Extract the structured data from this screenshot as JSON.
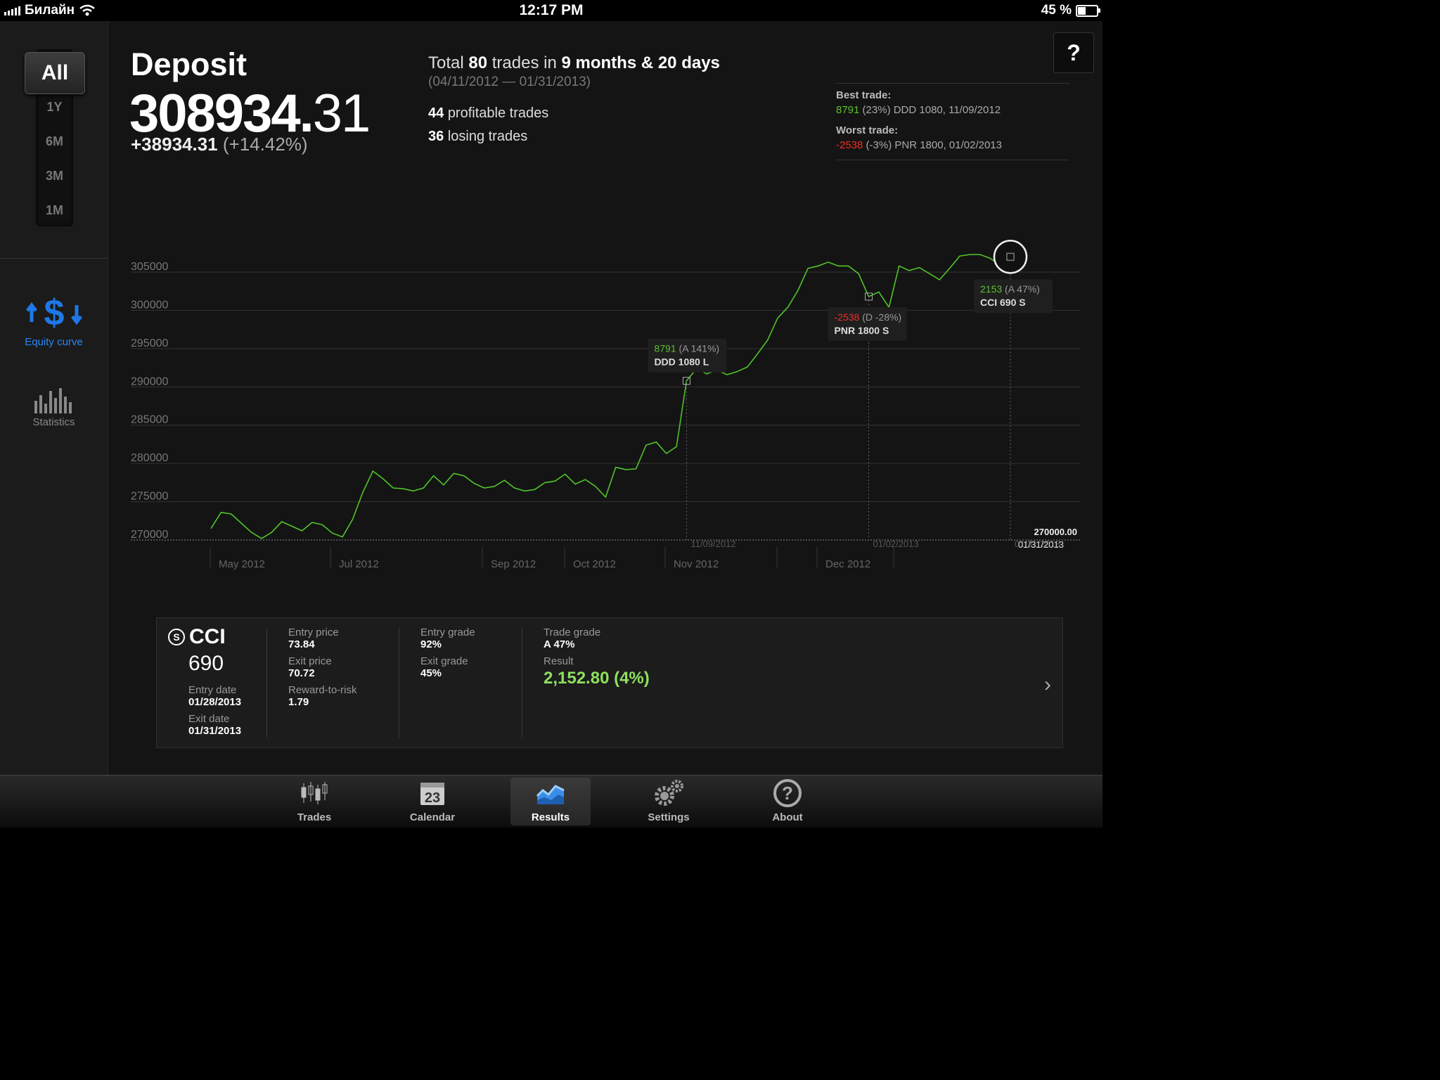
{
  "status_bar": {
    "carrier": "Билайн",
    "time": "12:17 PM",
    "battery": "45 %",
    "battery_level": 0.45
  },
  "sidebar": {
    "ranges": [
      "All",
      "1Y",
      "6M",
      "3M",
      "1M"
    ],
    "selected_range": "All",
    "nav": [
      {
        "label": "Equity curve",
        "icon": "equity-curve-icon",
        "active": true
      },
      {
        "label": "Statistics",
        "icon": "statistics-icon",
        "active": false
      }
    ]
  },
  "header": {
    "deposit_label": "Deposit",
    "deposit_whole": "308934.",
    "deposit_cents": "31",
    "change": "+38934.31",
    "change_pct": "(+14.42%)",
    "summary_prefix": "Total",
    "summary_trades": "80",
    "summary_mid": "trades in",
    "summary_period": "9 months & 20 days",
    "date_range": "(04/11/2012 — 01/31/2013)",
    "profitable_count": "44",
    "profitable_label": "profitable trades",
    "losing_count": "36",
    "losing_label": "losing trades",
    "help_label": "?",
    "best_trade_label": "Best trade:",
    "best_trade_value": "8791",
    "best_trade_rest": "(23%) DDD 1080, 11/09/2012",
    "worst_trade_label": "Worst trade:",
    "worst_trade_value": "-2538",
    "worst_trade_rest": "(-3%) PNR 1800, 01/02/2013"
  },
  "chart_data": {
    "type": "line",
    "ylim": [
      270000,
      305000
    ],
    "yticks": [
      "305000",
      "300000",
      "295000",
      "290000",
      "285000",
      "280000",
      "275000",
      "270000"
    ],
    "xticks": [
      "May 2012",
      "Jul 2012",
      "Sep 2012",
      "Oct 2012",
      "Nov 2012",
      "Dec 2012"
    ],
    "baseline_label": "270000.00",
    "baseline_date": "01/31/2013",
    "colors": {
      "line": "#4fc32a",
      "grid": "#333333"
    },
    "series": [
      {
        "values": [
          271500,
          273600,
          273400,
          272200,
          271000,
          270200,
          271000,
          272400,
          271800,
          271200,
          272300,
          272000,
          270900,
          270400,
          272700,
          276200,
          279000,
          278000,
          276800,
          276700,
          276400,
          276800,
          278400,
          277200,
          278700,
          278400,
          277400,
          276800,
          277000,
          277800,
          276800,
          276400,
          276600,
          277500,
          277700,
          278600,
          277300,
          277900,
          277000,
          275600,
          279500,
          279200,
          279300,
          282400,
          282800,
          281300,
          282200,
          290800,
          292400,
          291700,
          292200,
          291600,
          292000,
          292600,
          294300,
          296100,
          299000,
          300400,
          302600,
          305500,
          305800,
          306300,
          305800,
          305800,
          304800,
          301800,
          302400,
          300400,
          305800,
          305200,
          305600,
          304800,
          304000,
          305500,
          307100,
          307300,
          307300,
          306800,
          305900,
          307000
        ]
      }
    ],
    "annotations": [
      {
        "value": "8791",
        "grade": "(A 141%)",
        "trade": "DDD 1080 L",
        "date": "11/09/2012",
        "index": 47
      },
      {
        "value": "-2538",
        "grade": "(D -28%)",
        "trade": "PNR 1800 S",
        "date": "01/02/2013",
        "index": 65
      },
      {
        "value": "2153",
        "grade": "(A 47%)",
        "trade": "CCI 690 S",
        "date": "01/31/2013",
        "index": 79
      }
    ]
  },
  "trade_detail": {
    "symbol": "CCI",
    "quantity": "690",
    "entry_date_label": "Entry date",
    "entry_date": "01/28/2013",
    "exit_date_label": "Exit date",
    "exit_date": "01/31/2013",
    "entry_price_label": "Entry price",
    "entry_price": "73.84",
    "exit_price_label": "Exit price",
    "exit_price": "70.72",
    "reward_risk_label": "Reward-to-risk",
    "reward_risk": "1.79",
    "entry_grade_label": "Entry grade",
    "entry_grade": "92%",
    "exit_grade_label": "Exit grade",
    "exit_grade": "45%",
    "trade_grade_label": "Trade grade",
    "trade_grade": "A 47%",
    "result_label": "Result",
    "result": "2,152.80 (4%)"
  },
  "tab_bar": {
    "tabs": [
      {
        "label": "Trades",
        "icon": "candlestick-icon"
      },
      {
        "label": "Calendar",
        "icon": "calendar-icon",
        "icon_text": "23"
      },
      {
        "label": "Results",
        "icon": "results-chart-icon",
        "active": true
      },
      {
        "label": "Settings",
        "icon": "gear-icon"
      },
      {
        "label": "About",
        "icon": "help-circle-icon"
      }
    ]
  }
}
